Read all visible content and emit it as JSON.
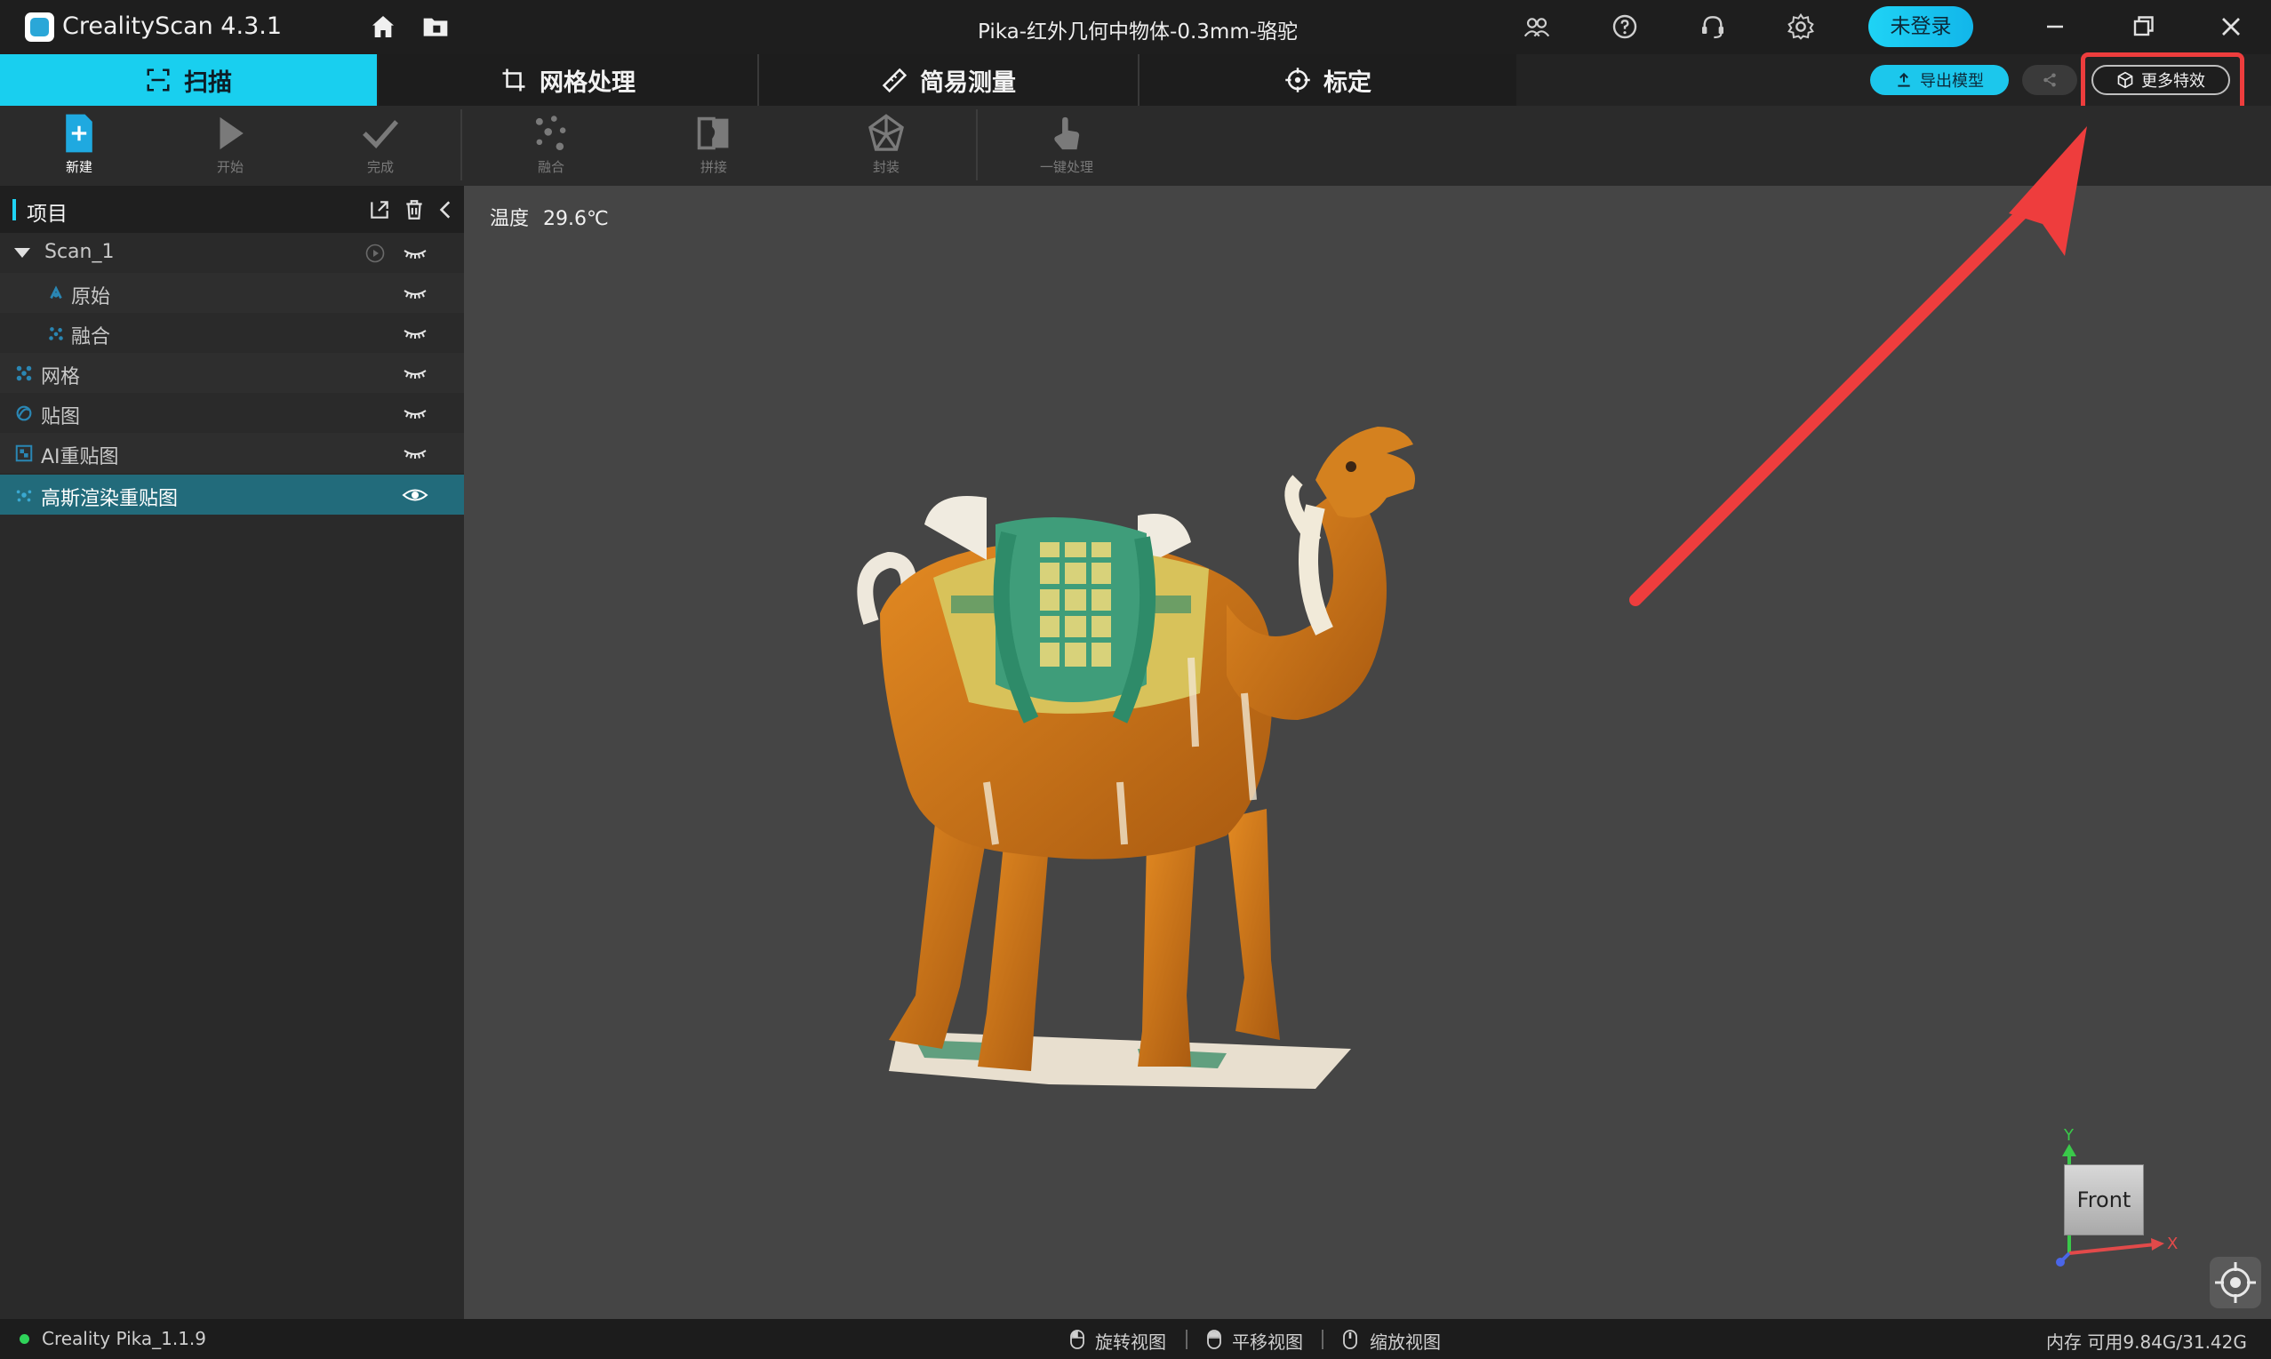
{
  "app": {
    "name": "CrealityScan 4.3.1",
    "window_title": "Pika-红外几何中物体-0.3mm-骆驼",
    "login_label": "未登录"
  },
  "tabs": [
    {
      "label": "扫描",
      "active": true
    },
    {
      "label": "网格处理",
      "active": false
    },
    {
      "label": "简易测量",
      "active": false
    },
    {
      "label": "标定",
      "active": false
    }
  ],
  "actions": {
    "export_label": "导出模型",
    "more_effects_label": "更多特效"
  },
  "toolbar": {
    "new": "新建",
    "start": "开始",
    "finish": "完成",
    "fuse": "融合",
    "stitch": "拼接",
    "encapsulate": "封装",
    "one_click": "一键处理"
  },
  "project_panel": {
    "title": "项目",
    "items": [
      {
        "label": "Scan_1",
        "level": 0
      },
      {
        "label": "原始",
        "level": 1
      },
      {
        "label": "融合",
        "level": 1
      },
      {
        "label": "网格",
        "level": 0
      },
      {
        "label": "贴图",
        "level": 0
      },
      {
        "label": "AI重贴图",
        "level": 0
      },
      {
        "label": "高斯渲染重贴图",
        "level": 0,
        "selected": true
      }
    ]
  },
  "viewport": {
    "temperature_label": "温度",
    "temperature_value": "29.6℃",
    "view_cube_label": "Front",
    "axis_y": "Y",
    "axis_x": "X"
  },
  "statusbar": {
    "device": "Creality Pika_1.1.9",
    "rotate": "旋转视图",
    "pan": "平移视图",
    "zoom": "缩放视图",
    "memory": "内存 可用9.84G/31.42G"
  },
  "colors": {
    "accent": "#19cfef",
    "highlight": "#ee3d3d",
    "selected_row": "#226b7b"
  }
}
